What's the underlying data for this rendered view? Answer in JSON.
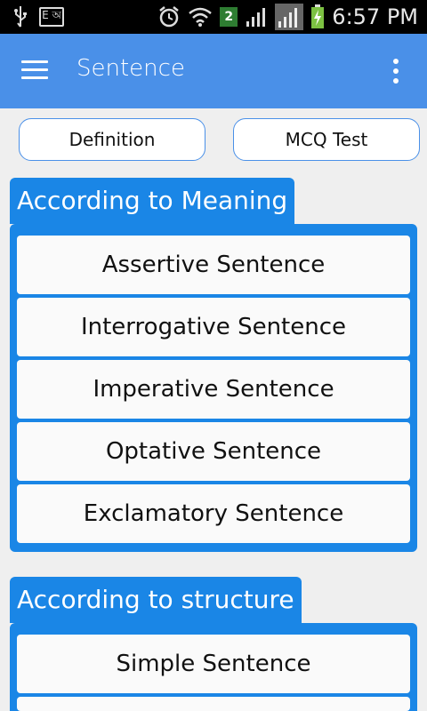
{
  "status_bar": {
    "time": "6:57 PM",
    "sim_badge": "2",
    "ebook_label": "E অ",
    "icons": [
      "usb-icon",
      "ebook-icon",
      "alarm-icon",
      "wifi-icon",
      "signal-icon",
      "signal-icon-2",
      "battery-charging-icon"
    ]
  },
  "app_bar": {
    "title": "Sentence",
    "menu_icon": "hamburger-menu-icon",
    "overflow_icon": "more-vert-icon"
  },
  "top_buttons": {
    "definition": "Definition",
    "mcq": "MCQ Test"
  },
  "sections": [
    {
      "title": "According to Meaning",
      "items": [
        "Assertive Sentence",
        "Interrogative Sentence",
        "Imperative Sentence",
        "Optative Sentence",
        "Exclamatory Sentence"
      ]
    },
    {
      "title": "According to structure",
      "items": [
        "Simple Sentence"
      ]
    }
  ],
  "colors": {
    "app_bar": "#4a90e8",
    "section": "#1a86e6",
    "background": "#efefef"
  }
}
